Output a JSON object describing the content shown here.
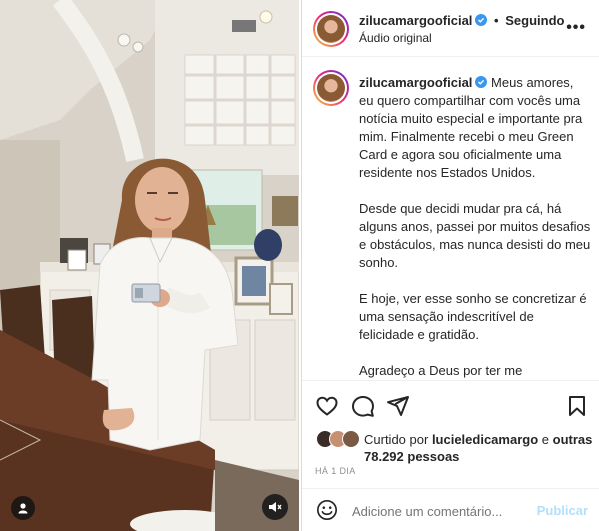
{
  "header": {
    "username": "zilucamargooficial",
    "separator": "•",
    "follow_status": "Seguindo",
    "audio_label": "Áudio original",
    "more_label": "•••"
  },
  "caption": {
    "username": "zilucamargooficial",
    "paragraphs": [
      "Meus amores, eu quero compartilhar com vocês uma notícia muito especial e importante pra mim. Finalmente recebi o meu Green Card e agora sou oficialmente uma residente nos Estados Unidos.",
      "Desde que decidi mudar pra cá, há alguns anos, passei por muitos desafios e obstáculos, mas nunca desisti do meu sonho.",
      "E hoje, ver esse sonho se concretizar é uma sensação indescritível de felicidade e gratidão.",
      "Agradeço a Deus por ter me"
    ]
  },
  "likes": {
    "prefix": "Curtido por",
    "user": "lucieledicamargo",
    "connector": "e",
    "others": "outras 78.292 pessoas"
  },
  "timestamp": "HÁ 1 DIA",
  "comment": {
    "placeholder": "Adicione um comentário...",
    "post_label": "Publicar"
  },
  "colors": {
    "verified": "#3897f0",
    "post_button": "#b2dffc",
    "muted_text": "#8e8e8e"
  }
}
